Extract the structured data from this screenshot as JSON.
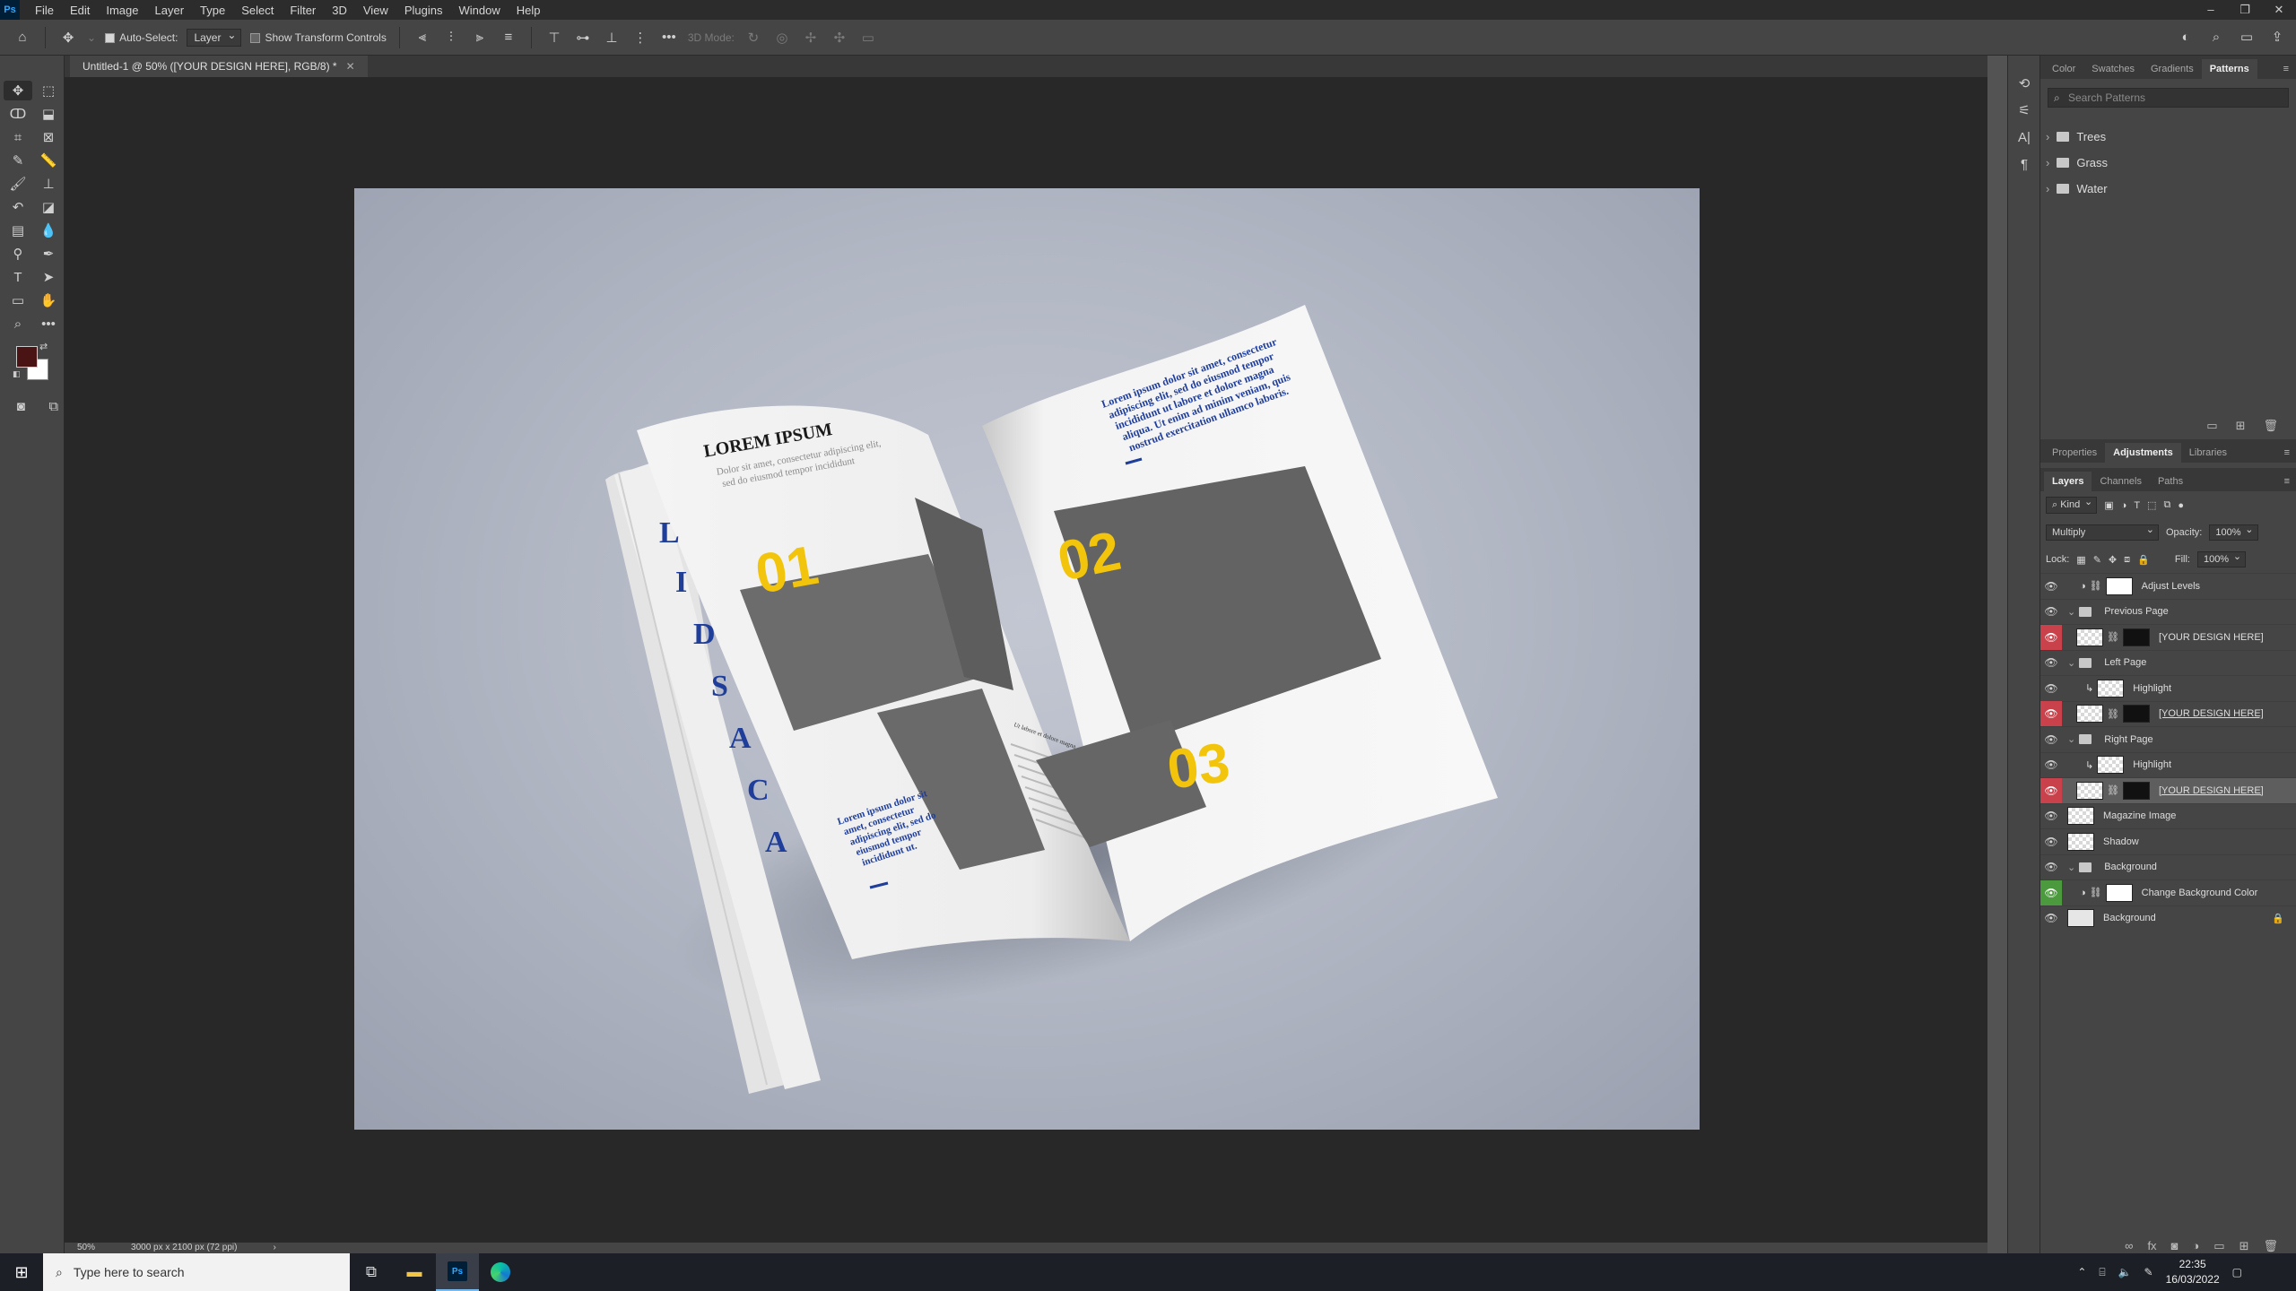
{
  "menu": {
    "items": [
      "File",
      "Edit",
      "Image",
      "Layer",
      "Type",
      "Select",
      "Filter",
      "3D",
      "View",
      "Plugins",
      "Window",
      "Help"
    ]
  },
  "options": {
    "auto_select_label": "Auto-Select:",
    "auto_select_value": "Layer",
    "transform_label": "Show Transform Controls",
    "mode_3d_label": "3D Mode:"
  },
  "document": {
    "tab_title": "Untitled-1 @ 50% ([YOUR DESIGN HERE], RGB/8) *",
    "zoom": "50%",
    "doc_size": "3000 px x 2100 px (72 ppi)"
  },
  "artwork": {
    "heading": "LOREM IPSUM",
    "subheading_1": "Dolor sit amet, consectetur adipiscing elit,",
    "subheading_2": "sed do eiusmod tempor incididunt",
    "num_01": "01",
    "num_02": "02",
    "num_03": "03",
    "spine_letters": [
      "L",
      "I",
      "D",
      "S",
      "A",
      "C",
      "A"
    ],
    "right_para": [
      "Lorem ipsum dolor sit amet, consectetur",
      "adipiscing elit, sed do eiusmod tempor",
      "incididunt ut labore et dolore magna",
      "aliqua. Ut enim ad minim veniam, quis",
      "nostrud exercitation ullamco laboris."
    ],
    "left_para": [
      "Lorem ipsum dolor sit",
      "amet, consectetur",
      "adipiscing elit, sed do",
      "eiusmod tempor",
      "incididunt ut."
    ],
    "small_caption": "Ut labore et dolore magna"
  },
  "top_panel": {
    "tabs": [
      "Color",
      "Swatches",
      "Gradients",
      "Patterns"
    ],
    "active_tab": "Patterns",
    "search_placeholder": "Search Patterns",
    "folders": [
      "Trees",
      "Grass",
      "Water"
    ]
  },
  "mid_panel": {
    "tabs": [
      "Properties",
      "Adjustments",
      "Libraries"
    ],
    "active_tab": "Adjustments"
  },
  "layers_panel": {
    "tabs": [
      "Layers",
      "Channels",
      "Paths"
    ],
    "active_tab": "Layers",
    "filter_kind": "Kind",
    "blend_mode": "Multiply",
    "opacity_label": "Opacity:",
    "opacity_value": "100%",
    "lock_label": "Lock:",
    "fill_label": "Fill:",
    "fill_value": "100%",
    "layers": [
      {
        "name": "Adjust Levels",
        "eye": "normal",
        "indent": 1,
        "kind": "adjust"
      },
      {
        "name": "Previous Page",
        "eye": "normal",
        "indent": 0,
        "kind": "group"
      },
      {
        "name": "[YOUR DESIGN HERE]",
        "eye": "red",
        "indent": 1,
        "kind": "smart"
      },
      {
        "name": "Left Page",
        "eye": "normal",
        "indent": 0,
        "kind": "group"
      },
      {
        "name": "Highlight",
        "eye": "normal",
        "indent": 2,
        "kind": "pixel"
      },
      {
        "name": "[YOUR DESIGN HERE]",
        "eye": "red",
        "indent": 1,
        "kind": "smart"
      },
      {
        "name": "Right Page",
        "eye": "normal",
        "indent": 0,
        "kind": "group"
      },
      {
        "name": "Highlight",
        "eye": "normal",
        "indent": 2,
        "kind": "pixel"
      },
      {
        "name": "[YOUR DESIGN HERE]",
        "eye": "red",
        "indent": 1,
        "kind": "smart",
        "selected": true
      },
      {
        "name": "Magazine Image",
        "eye": "normal",
        "indent": 0,
        "kind": "pixel"
      },
      {
        "name": "Shadow",
        "eye": "normal",
        "indent": 0,
        "kind": "pixel"
      },
      {
        "name": "Background",
        "eye": "normal",
        "indent": 0,
        "kind": "group"
      },
      {
        "name": "Change Background Color",
        "eye": "green",
        "indent": 1,
        "kind": "adjust"
      },
      {
        "name": "Background",
        "eye": "normal",
        "indent": 0,
        "kind": "background",
        "locked": true
      }
    ]
  },
  "taskbar": {
    "search_placeholder": "Type here to search",
    "time": "22:35",
    "date": "16/03/2022"
  },
  "colors": {
    "foreground": "#4a1414",
    "background": "#ffffff",
    "accent_yellow": "#f2c40c",
    "accent_blue": "#1f3e9a"
  }
}
